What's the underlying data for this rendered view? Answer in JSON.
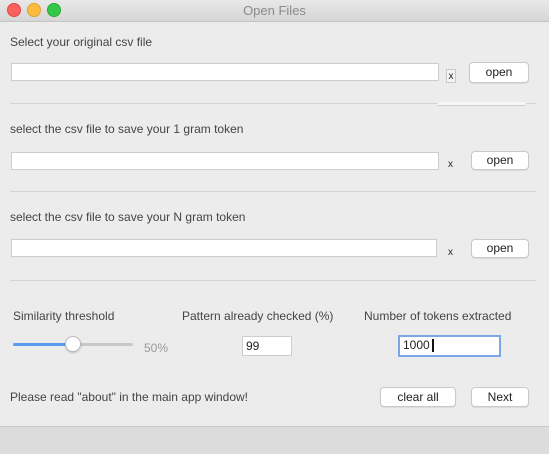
{
  "window": {
    "title": "Open Files"
  },
  "sections": [
    {
      "label": "Select your original csv file",
      "path_value": "",
      "clear_label": "x",
      "open_label": "open"
    },
    {
      "label": "select the csv file to save your 1 gram token",
      "path_value": "",
      "clear_label": "x",
      "open_label": "open"
    },
    {
      "label": "select the csv file to save your N gram token",
      "path_value": "",
      "clear_label": "x",
      "open_label": "open"
    }
  ],
  "settings": {
    "similarity": {
      "label": "Similarity threshold",
      "value": 0.5,
      "value_text": "50%"
    },
    "pattern": {
      "label": "Pattern already checked (%)",
      "value": "99"
    },
    "tokens": {
      "label": "Number of tokens extracted",
      "value": "1000"
    }
  },
  "footer": {
    "note": "Please read \"about\" in the main app window!",
    "clear_all_label": "clear all",
    "next_label": "Next"
  },
  "colors": {
    "accent": "#5a9cf0"
  }
}
